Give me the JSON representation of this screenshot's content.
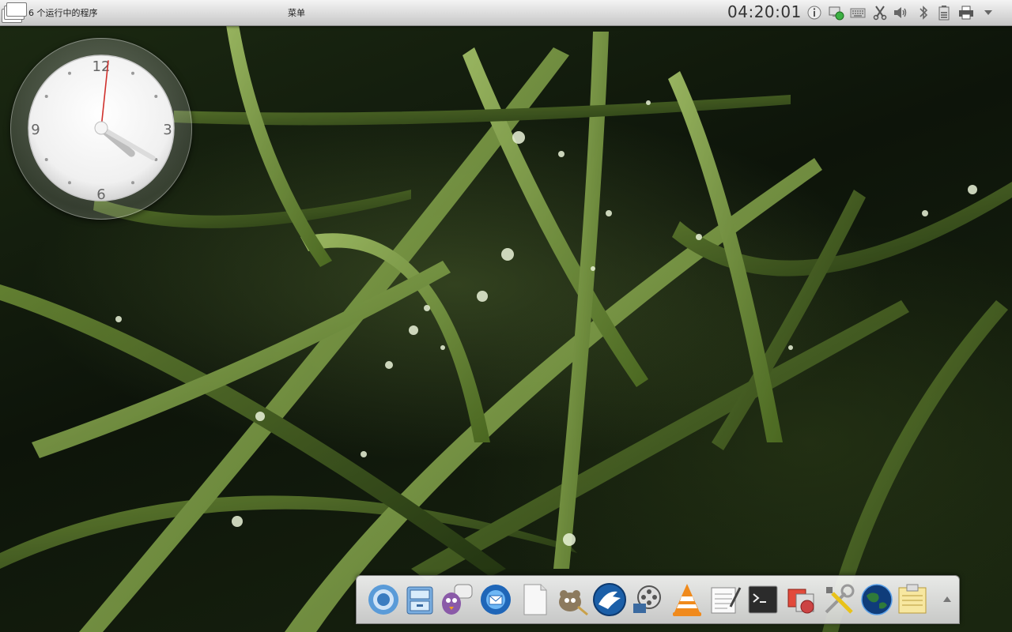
{
  "top_panel": {
    "task_switcher_icon": "window-stack-icon",
    "task_count_label": "6 个运行中的程序",
    "menu_label": "菜单",
    "clock_time": "04:20:01",
    "tray_icons": [
      "info-icon",
      "network-icon",
      "keyboard-icon",
      "clipboard-scissors-icon",
      "volume-icon",
      "bluetooth-icon",
      "battery-icon",
      "printer-icon",
      "tray-expand-arrow-icon"
    ]
  },
  "clock_widget": {
    "numerals": [
      "12",
      "3",
      "6",
      "9"
    ],
    "hour": 4,
    "minute": 20,
    "second": 1
  },
  "dock": {
    "items": [
      "chromium-icon",
      "file-manager-icon",
      "pidgin-chat-icon",
      "thunderbird-mail-icon",
      "text-document-icon",
      "gimp-icon",
      "wolf-browser-icon",
      "video-editor-icon",
      "vlc-icon",
      "text-editor-icon",
      "terminal-icon",
      "software-center-icon",
      "settings-tools-icon",
      "globe-icon",
      "notes-icon"
    ],
    "expand_icon": "dock-expand-arrow-icon"
  },
  "colors": {
    "clock_second_hand": "#d0312d",
    "panel_text": "#222222",
    "network_green": "#3cb043"
  }
}
